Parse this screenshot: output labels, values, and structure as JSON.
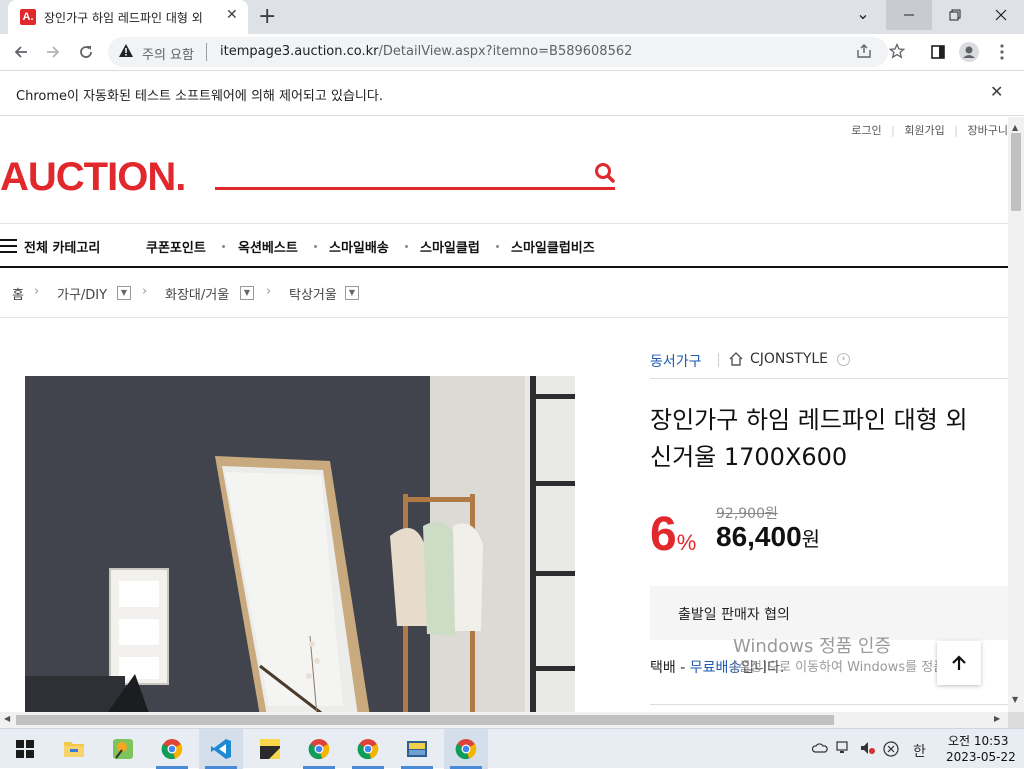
{
  "browser": {
    "tab_title": "장인가구 하임 레드파인 대형 외",
    "favicon_text": "A.",
    "security_label": "주의 요함",
    "url_host": "itempage3.auction.co.kr",
    "url_path": "/DetailView.aspx?itemno=B589608562",
    "infobar_text": "Chrome이 자동화된 테스트 소프트웨어에 의해 제어되고 있습니다."
  },
  "site": {
    "util_links": [
      "로그인",
      "회원가입",
      "장바구니"
    ],
    "logo": "AUCTION.",
    "brand_color": "#e0282d",
    "gnb_all": "전체 카테고리",
    "gnb_items": [
      "쿠폰포인트",
      "옥션베스트",
      "스마일배송",
      "스마일클럽",
      "스마일클럽비즈"
    ]
  },
  "breadcrumb": {
    "home": "홈",
    "items": [
      "가구/DIY",
      "화장대/거울",
      "탁상거울"
    ]
  },
  "product": {
    "seller": "동서가구",
    "store": "CJONSTYLE",
    "title": "장인가구 하임 레드파인 대형 외\n신거울 1700X600",
    "discount_value": "6",
    "discount_unit": "%",
    "original_price": "92,900원",
    "sale_price": "86,400",
    "sale_unit": "원",
    "shipping_notice": "출발일 판매자 협의",
    "delivery_label": "택배 - ",
    "delivery_free": "무료배송",
    "delivery_tail": "입니다."
  },
  "watermark": {
    "line1": "Windows 정품 인증",
    "line2": "[설정]으로 이동하여 Windows를 정품"
  },
  "taskbar": {
    "apps": [
      "file-explorer",
      "paint",
      "chrome",
      "vscode",
      "sticky-notes",
      "chrome",
      "chrome",
      "python",
      "chrome"
    ],
    "clock_time": "오전 10:53",
    "clock_date": "2023-05-22",
    "ime": "한"
  }
}
